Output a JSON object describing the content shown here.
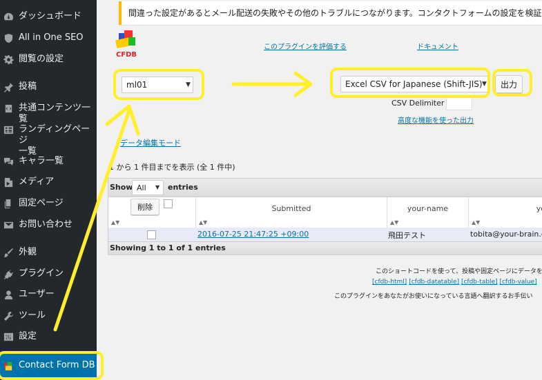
{
  "sidebar": {
    "items": [
      {
        "label": "ダッシュボード",
        "icon": "dashboard-icon"
      },
      {
        "label": "All in One SEO",
        "icon": "shield-icon"
      },
      {
        "label": "閲覧の設定",
        "icon": "gear-icon"
      },
      {
        "label": "投稿",
        "icon": "pin-icon"
      },
      {
        "label": "共通コンテンツ一覧",
        "icon": "code-icon"
      },
      {
        "label": "ランディングページ一覧",
        "label_line1": "ランディングページ",
        "label_line2": "一覧",
        "icon": "grid-icon"
      },
      {
        "label": "キャラ一覧",
        "icon": "comments-icon"
      },
      {
        "label": "メディア",
        "icon": "media-icon"
      },
      {
        "label": "固定ページ",
        "icon": "page-icon"
      },
      {
        "label": "お問い合わせ",
        "icon": "mail-icon"
      },
      {
        "label": "外観",
        "icon": "brush-icon"
      },
      {
        "label": "プラグイン",
        "icon": "plug-icon"
      },
      {
        "label": "ユーザー",
        "icon": "user-icon"
      },
      {
        "label": "ツール",
        "icon": "wrench-icon"
      },
      {
        "label": "設定",
        "icon": "settings-icon"
      },
      {
        "label": "Contact Form DB",
        "icon": "cfdb-icon",
        "active": true
      }
    ]
  },
  "notice": {
    "text": "間違った設定があるとメール配送の失敗やその他のトラブルにつながります。コンタクトフォームの設定を検証しましょう。 »"
  },
  "logo": {
    "text": "CFDB"
  },
  "links": {
    "rate_plugin": "このプラグインを評価する",
    "docs": "ドキュメント",
    "advanced_export": "高度な機能を使った出力",
    "edit_mode": "データ編集モード"
  },
  "form_select": {
    "value": "ml01"
  },
  "export_select": {
    "value": "Excel CSV for Japanese (Shift-JIS)"
  },
  "export_button": {
    "label": "出力"
  },
  "csv_delimiter": {
    "label": "CSV Delimiter",
    "value": ""
  },
  "count_text": "1 から 1 件目までを表示 (全 1 件中)",
  "datatable": {
    "show_label": "Show",
    "show_value": "All",
    "entries_label": "entries",
    "delete_button": "削除",
    "columns": [
      "Submitted",
      "your-name",
      "you"
    ],
    "rows": [
      {
        "submitted": "2016-07-25 21:47:25 +09:00",
        "your_name": "飛田テスト",
        "email": "tobita@your-brain.c"
      }
    ],
    "footer": "Showing 1 to 1 of 1 entries"
  },
  "footer": {
    "line1": "このショートコードを使って、投稿や固定ページにデータを表",
    "shortcodes": [
      "[cfdb-html]",
      "[cfdb-datatable]",
      "[cfdb-table]",
      "[cfdb-value]"
    ],
    "line3": "このプラグインをあなたがお使いになっている言語へ翻訳するお手伝い"
  },
  "colors": {
    "highlight": "#ffef2a",
    "sidebar": "#23282d",
    "active": "#0073aa",
    "link": "#0073aa"
  }
}
